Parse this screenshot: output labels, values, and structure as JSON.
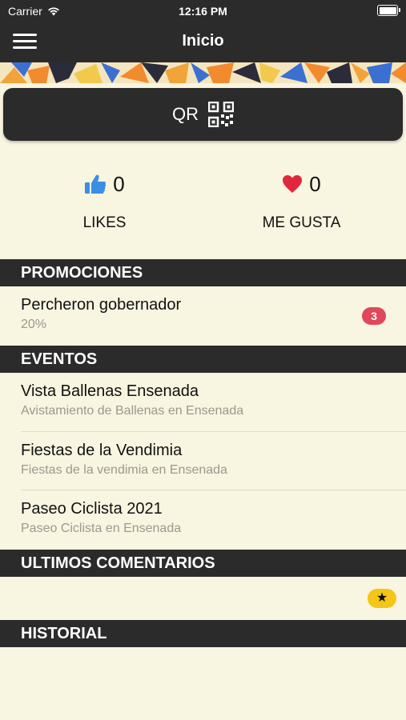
{
  "status_bar": {
    "carrier": "Carrier",
    "time": "12:16 PM"
  },
  "nav": {
    "title": "Inicio"
  },
  "qr_button": {
    "label": "QR"
  },
  "stats": {
    "likes": {
      "count": "0",
      "label": "LIKES"
    },
    "me_gusta": {
      "count": "0",
      "label": "ME GUSTA"
    }
  },
  "sections": {
    "promociones": "PROMOCIONES",
    "eventos": "EVENTOS",
    "comentarios": "ULTIMOS COMENTARIOS",
    "historial": "HISTORIAL"
  },
  "promociones": [
    {
      "title": "Percheron gobernador",
      "subtitle": "20%",
      "badge": "3"
    }
  ],
  "eventos": [
    {
      "title": "Vista Ballenas Ensenada",
      "subtitle": "Avistamiento de Ballenas en Ensenada"
    },
    {
      "title": "Fiestas de la Vendimia",
      "subtitle": "Fiestas de la vendimia en Ensenada"
    },
    {
      "title": "Paseo Ciclista 2021",
      "subtitle": "Paseo Ciclista en Ensenada"
    }
  ],
  "comentarios": {
    "badge": "★"
  },
  "colors": {
    "background": "#f8f5e0",
    "bar": "#2b2b2c",
    "like_blue": "#3a8ee6",
    "heart_red": "#e0283c",
    "badge_red": "#e0475a",
    "badge_yellow": "#f5c518"
  }
}
